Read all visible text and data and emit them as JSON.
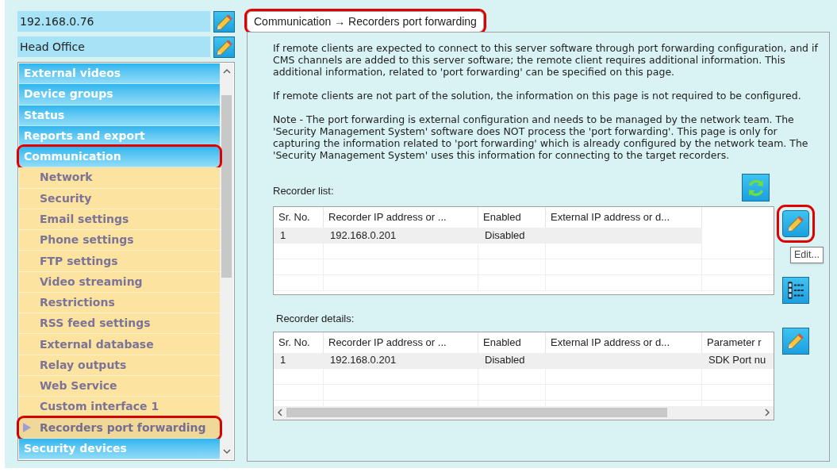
{
  "server_field": {
    "value": "192.168.0.76"
  },
  "site_field": {
    "value": "Head Office"
  },
  "sidebar": {
    "items": [
      {
        "label": "External videos",
        "selected": false
      },
      {
        "label": "Device groups",
        "selected": false
      },
      {
        "label": "Status",
        "selected": false
      },
      {
        "label": "Reports and export",
        "selected": false
      },
      {
        "label": "Communication",
        "selected": false,
        "expanded": true,
        "annotated": true,
        "children": [
          {
            "label": "Network",
            "selected": false
          },
          {
            "label": "Security",
            "selected": false
          },
          {
            "label": "Email settings",
            "selected": false
          },
          {
            "label": "Phone settings",
            "selected": false
          },
          {
            "label": "FTP settings",
            "selected": false
          },
          {
            "label": "Video streaming",
            "selected": false
          },
          {
            "label": "Restrictions",
            "selected": false
          },
          {
            "label": "RSS feed settings",
            "selected": false
          },
          {
            "label": "External database",
            "selected": false
          },
          {
            "label": "Relay outputs",
            "selected": false
          },
          {
            "label": "Web Service",
            "selected": false
          },
          {
            "label": "Custom interface 1",
            "selected": false
          },
          {
            "label": "Recorders port forwarding",
            "selected": true,
            "annotated": true
          }
        ]
      },
      {
        "label": "Security devices",
        "selected": false
      }
    ]
  },
  "tab": {
    "label": "Communication → Recorders port forwarding",
    "annotated": true
  },
  "paragraphs": [
    "If remote clients are expected to connect to this server software through port forwarding configuration, and if CMS channels are added to this server software; the remote client requires additional information. This additional information, related to 'port forwarding' can be specified on this page.",
    "If remote clients are not part of the solution, the information on this page is not required to be configured.",
    "Note - The port forwarding is external configuration and needs to be managed by the network team. The 'Security Management System' software does NOT process the 'port forwarding'. This page is only for capturing the information related to 'port forwarding' which is already configured by the network team. The 'Security Management System' uses this information for connecting to the target recorders."
  ],
  "recorder_list": {
    "label": "Recorder list:",
    "columns": [
      "Sr. No.",
      "Recorder IP address or ...",
      "Enabled",
      "External IP address or d..."
    ],
    "rows": [
      {
        "cells": [
          "1",
          "192.168.0.201",
          "Disabled",
          ""
        ],
        "selected": true
      }
    ]
  },
  "recorder_details": {
    "label": "Recorder details:",
    "columns": [
      "Sr. No.",
      "Recorder IP address or ...",
      "Enabled",
      "External IP address or d...",
      "Parameter r"
    ],
    "rows": [
      {
        "cells": [
          "1",
          "192.168.0.201",
          "Disabled",
          "",
          "SDK Port nu"
        ],
        "selected": true
      }
    ]
  },
  "edit_button": {
    "annotated": true,
    "tooltip": "Edit..."
  }
}
